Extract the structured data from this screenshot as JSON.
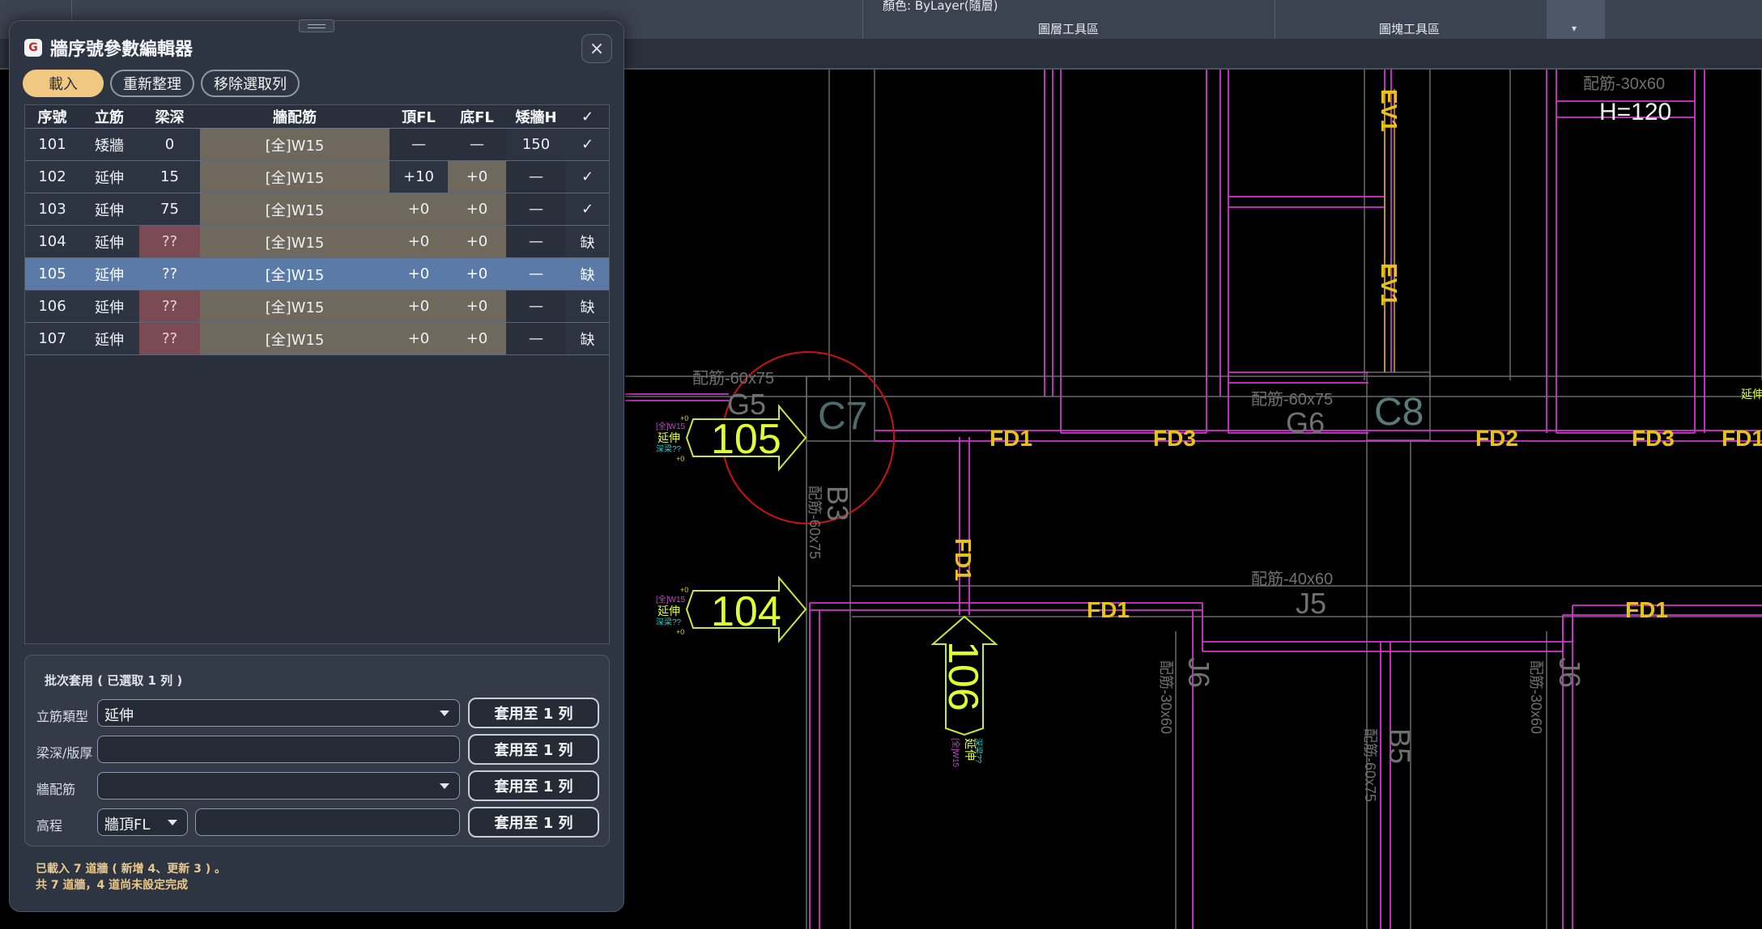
{
  "ribbon": {
    "color_label": "顏色: ByLayer(隨層)",
    "group_layer": "圖層工具區",
    "group_block": "圖塊工具區"
  },
  "drawing_labels": {
    "wall_105": "105",
    "wall_104": "104",
    "wall_106": "106",
    "c7": "C7",
    "c8": "C8",
    "g5": "G5",
    "g6": "G6",
    "j5": "J5",
    "j6a": "J6",
    "j6b": "J6",
    "b3": "B3",
    "b5": "B5",
    "fd1": "FD1",
    "fd2": "FD2",
    "fd3": "FD3",
    "ev1": "EV1",
    "h120": "H=120",
    "rebar_g5": "配筋-60x75",
    "rebar_g6": "配筋-60x75",
    "rebar_j5": "配筋-40x60",
    "rebar_top": "配筋-30x60",
    "rebar_j6": "配筋-30x60",
    "rebar_b3": "配筋-60x75",
    "rebar_b5": "配筋-60x75",
    "tag_plus": "+0",
    "tag_rebar": "[全]W15",
    "tag_type": "延伸",
    "tag_depth": "深梁??"
  },
  "dialog": {
    "title": "牆序號參數編輯器",
    "close_symbol": "×",
    "toolbar": {
      "load": "載入",
      "reorganize": "重新整理",
      "remove_selected": "移除選取列"
    },
    "table": {
      "headers": [
        "序號",
        "立筋",
        "梁深",
        "牆配筋",
        "頂FL",
        "底FL",
        "矮牆H",
        "✓"
      ],
      "rows": [
        {
          "id": "101",
          "type": "矮牆",
          "depth": "0",
          "rebar": "[全]W15",
          "top": "—",
          "bottom": "—",
          "low": "150",
          "status": "✓"
        },
        {
          "id": "102",
          "type": "延伸",
          "depth": "15",
          "rebar": "[全]W15",
          "top": "+10",
          "bottom": "+0",
          "low": "—",
          "status": "✓"
        },
        {
          "id": "103",
          "type": "延伸",
          "depth": "75",
          "rebar": "[全]W15",
          "top": "+0",
          "bottom": "+0",
          "low": "—",
          "status": "✓"
        },
        {
          "id": "104",
          "type": "延伸",
          "depth": "??",
          "rebar": "[全]W15",
          "top": "+0",
          "bottom": "+0",
          "low": "—",
          "status": "缺"
        },
        {
          "id": "105",
          "type": "延伸",
          "depth": "??",
          "rebar": "[全]W15",
          "top": "+0",
          "bottom": "+0",
          "low": "—",
          "status": "缺"
        },
        {
          "id": "106",
          "type": "延伸",
          "depth": "??",
          "rebar": "[全]W15",
          "top": "+0",
          "bottom": "+0",
          "low": "—",
          "status": "缺"
        },
        {
          "id": "107",
          "type": "延伸",
          "depth": "??",
          "rebar": "[全]W15",
          "top": "+0",
          "bottom": "+0",
          "low": "—",
          "status": "缺"
        }
      ]
    },
    "batch": {
      "title": "批次套用 ( 已選取 1 列 )",
      "rebar_type_label": "立筋類型",
      "rebar_type_value": "延伸",
      "depth_label": "梁深/版厚",
      "depth_value": "",
      "wall_rebar_label": "牆配筋",
      "wall_rebar_value": "",
      "elevation_label": "高程",
      "elevation_mode": "牆頂FL",
      "elevation_value": "",
      "apply_label": "套用至 1 列"
    },
    "status_line1": "已載入 7 道牆 ( 新增 4、更新 3 ) 。",
    "status_line2": "共 7 道牆，4 道尚未設定完成"
  }
}
